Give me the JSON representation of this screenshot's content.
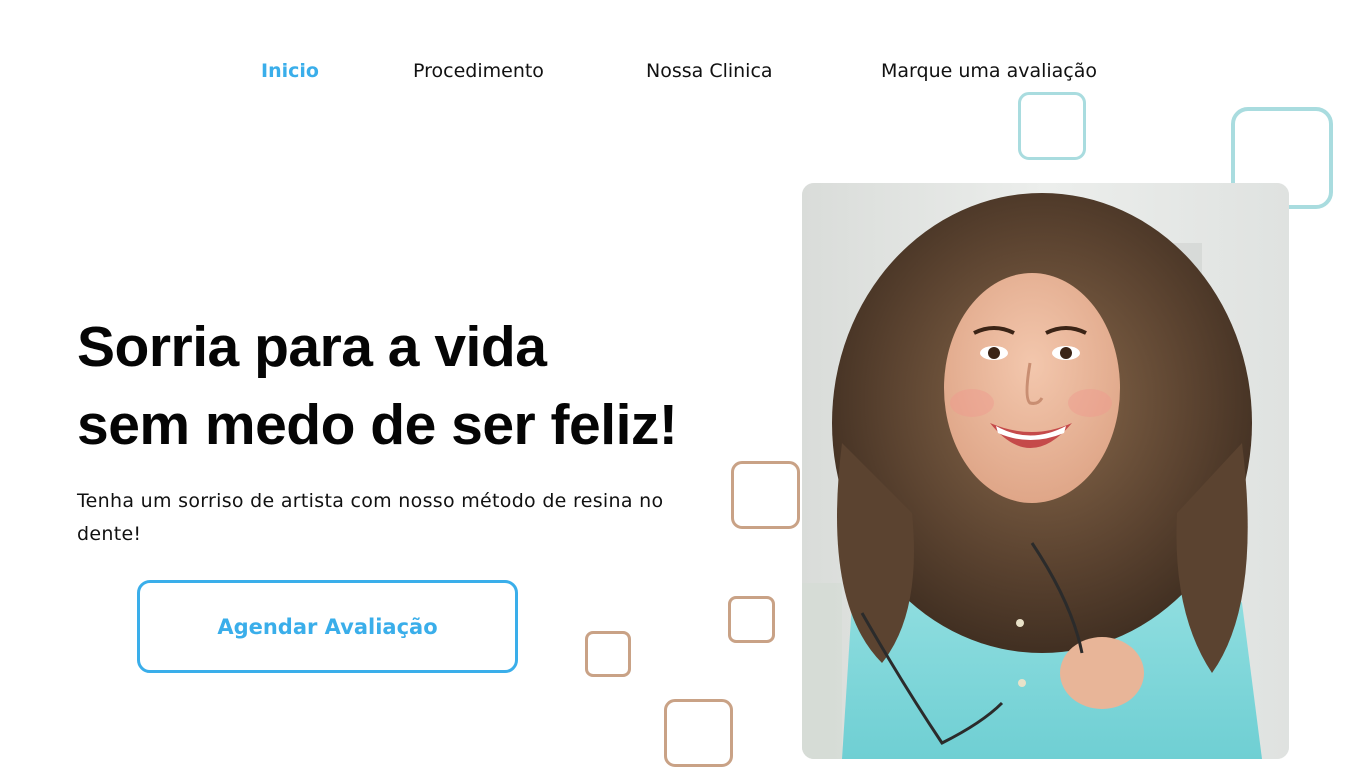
{
  "nav": {
    "items": [
      {
        "label": "Inicio",
        "active": true
      },
      {
        "label": "Procedimento",
        "active": false
      },
      {
        "label": "Nossa Clinica",
        "active": false
      },
      {
        "label": "Marque uma avaliação",
        "active": false
      }
    ]
  },
  "hero": {
    "headline_line1": "Sorria para a vida",
    "headline_line2": "sem medo de ser feliz!",
    "subtitle": "Tenha um sorriso de artista com nosso método de resina no dente!",
    "cta_label": "Agendar Avaliação"
  },
  "colors": {
    "accent": "#3aaeea",
    "teal_deco": "#a9dcdf",
    "tan_deco": "#c9a286",
    "text": "#050505"
  },
  "icons": {
    "photo": "woman-smiling-photo"
  }
}
